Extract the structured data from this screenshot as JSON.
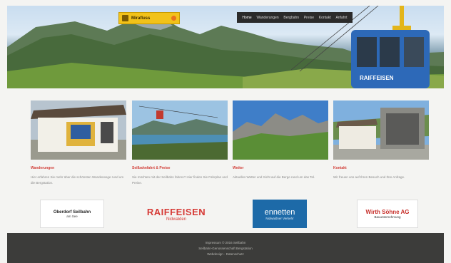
{
  "brand": {
    "logo_text": "Mirafluss"
  },
  "nav": {
    "items": [
      "Home",
      "Wanderungen",
      "Bergbahn",
      "Preise",
      "Kontakt",
      "Anfahrt"
    ]
  },
  "cards": [
    {
      "title": "Wanderungen",
      "desc": "Hier erfahren Sie mehr über die schönsten Wanderwege rund um die Bergstation."
    },
    {
      "title": "Seilbahnfahrt & Preise",
      "desc": "Sie möchten mit der Seilbahn fahren? Hier finden Sie Fahrplan und Preise."
    },
    {
      "title": "Wetter",
      "desc": "Aktuelles Wetter und Sicht auf die Berge rund um das Tal."
    },
    {
      "title": "Kontakt",
      "desc": "Wir freuen uns auf Ihren Besuch und Ihre Anfrage."
    }
  ],
  "sponsors": [
    {
      "name": "Oberdorf Seilbahn",
      "sub": "am See"
    },
    {
      "name": "RAIFFEISEN",
      "sub": "Nidwalden"
    },
    {
      "name": "ennetten",
      "sub": "Nidwaldner Verkehr"
    },
    {
      "name": "Wirth Söhne AG",
      "sub": "Bauunternehmung"
    }
  ],
  "footer": {
    "line1": "Impressum © 2016 Seilbahn",
    "line2": "Seilbahn-Genossenschaft Bergstation",
    "line3": "Webdesign · Datenschutz"
  },
  "colors": {
    "accent_red": "#d2403a",
    "logo_yellow": "#f2c21a",
    "nav_bg": "#2b2b2b",
    "footer_bg": "#3c3c3a"
  }
}
